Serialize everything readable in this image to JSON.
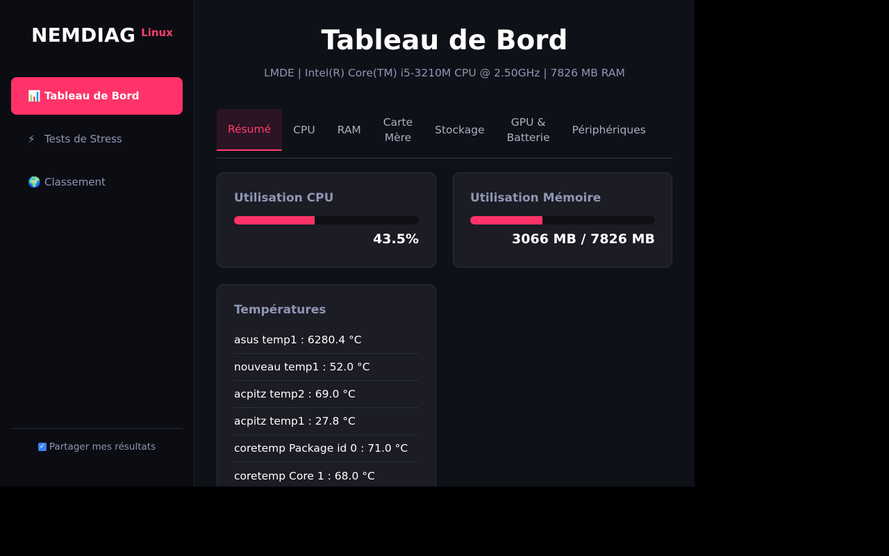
{
  "brand": {
    "name": "NEMDIAG",
    "os": "Linux"
  },
  "nav": [
    {
      "icon": "📊",
      "icon_name": "bar-chart-icon",
      "label": "Tableau de Bord"
    },
    {
      "icon": "⚡",
      "icon_name": "lightning-icon",
      "label": "Tests de Stress"
    },
    {
      "icon": "🌍",
      "icon_name": "globe-icon",
      "label": "Classement"
    }
  ],
  "footer": {
    "share_label": "Partager mes résultats",
    "share_checked": true
  },
  "header": {
    "title": "Tableau de Bord",
    "subtitle": "LMDE | Intel(R) Core(TM) i5-3210M CPU @ 2.50GHz | 7826 MB RAM"
  },
  "tabs": [
    {
      "label": "Résumé",
      "active": true
    },
    {
      "label": "CPU"
    },
    {
      "label": "RAM"
    },
    {
      "label": "Carte\nMère"
    },
    {
      "label": "Stockage"
    },
    {
      "label": "GPU &\nBatterie"
    },
    {
      "label": "Périphériques"
    }
  ],
  "cpu_card": {
    "title": "Utilisation CPU",
    "value_label": "43.5%",
    "percent": 43.5
  },
  "mem_card": {
    "title": "Utilisation Mémoire",
    "value_label": "3066 MB / 7826 MB",
    "used": 3066,
    "total": 7826
  },
  "temp_card": {
    "title": "Températures",
    "items": [
      "asus temp1 : 6280.4 °C",
      "nouveau temp1 : 52.0 °C",
      "acpitz temp2 : 69.0 °C",
      "acpitz temp1 : 27.8 °C",
      "coretemp Package id 0 : 71.0 °C",
      "coretemp Core 1 : 68.0 °C"
    ]
  },
  "colors": {
    "accent": "#ff3369",
    "background": "#0f1118",
    "sidebar": "#0c0d13",
    "card": "#1b1c24",
    "muted": "#8f97b3"
  }
}
